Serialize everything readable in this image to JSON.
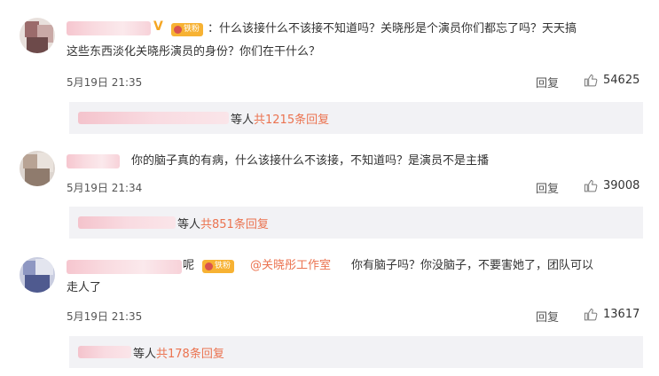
{
  "comments": [
    {
      "text_line1": "：什么该接什么不该接不知道吗？关晓彤是个演员你们都忘了吗？天天搞",
      "text_line2": "这些东西淡化关晓彤演员的身份？你们在干什么？",
      "time": "5月19日 21:35",
      "reply_label": "回复",
      "likes": "54625",
      "sub_prefix": "等人",
      "sub_count": "共1215条回复",
      "badges": {
        "v": "V",
        "fan": "铁粉"
      }
    },
    {
      "text_line1": "你的脑子真的有病，什么该接什么不该接，不知道吗？是演员不是主播",
      "time": "5月19日 21:34",
      "reply_label": "回复",
      "likes": "39008",
      "sub_prefix": "等人",
      "sub_count": "共851条回复"
    },
    {
      "text_line1_suffix": "呢",
      "mention": "@关晓彤工作室",
      "text_line1": "你有脑子吗？你没脑子，不要害她了，团队可以",
      "text_line2": "走人了",
      "time": "5月19日 21:35",
      "reply_label": "回复",
      "likes": "13617",
      "sub_prefix": "等人",
      "sub_count": "共178条回复",
      "badges": {
        "fan": "铁粉"
      }
    }
  ],
  "colors": {
    "accent": "#eb7350",
    "badge": "#f7b233",
    "v": "#f5a623",
    "subBox": "#f2f2f5"
  }
}
